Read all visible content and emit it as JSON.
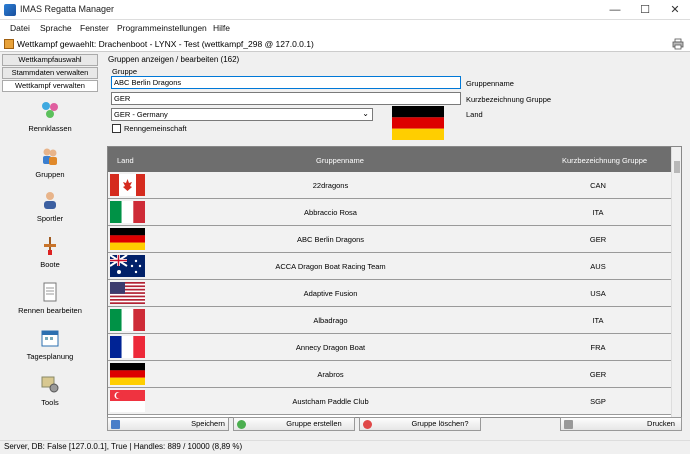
{
  "window": {
    "title": "IMAS Regatta Manager",
    "minimize": "—",
    "maximize": "☐",
    "close": "✕"
  },
  "menu": [
    "Datei",
    "Sprache",
    "Fenster",
    "Programmeinstellungen",
    "Hilfe"
  ],
  "context": {
    "text": "Wettkampf gewaehlt: Drachenboot - LYNX - Test (wettkampf_298 @ 127.0.0.1)"
  },
  "sidebar": {
    "tabs": [
      "Wettkampfauswahl",
      "Stammdaten verwalten",
      "Wettkampf verwalten"
    ],
    "items": [
      {
        "label": "Rennklassen",
        "icon": "molecule-icon"
      },
      {
        "label": "Gruppen",
        "icon": "group-icon"
      },
      {
        "label": "Sportler",
        "icon": "person-icon"
      },
      {
        "label": "Boote",
        "icon": "paddle-icon"
      },
      {
        "label": "Rennen bearbeiten",
        "icon": "document-icon"
      },
      {
        "label": "Tagesplanung",
        "icon": "calendar-icon"
      },
      {
        "label": "Tools",
        "icon": "tools-icon"
      }
    ]
  },
  "form": {
    "section_title": "Gruppen anzeigen / bearbeiten (162)",
    "groupbox_title": "Gruppe",
    "name_value": "ABC Berlin Dragons",
    "name_label": "Gruppenname",
    "short_value": "GER",
    "short_label": "Kurzbezeichnung Gruppe",
    "country_value": "GER - Germany",
    "country_label": "Land",
    "dropdown_arrow": "⌄",
    "renngemeinschaft_label": "Renngemeinschaft"
  },
  "table": {
    "headers": [
      "Land",
      "Gruppenname",
      "Kurzbezeichnung Gruppe"
    ],
    "rows": [
      {
        "flag": "CAN",
        "name": "22dragons",
        "code": "CAN"
      },
      {
        "flag": "ITA",
        "name": "Abbraccio Rosa",
        "code": "ITA"
      },
      {
        "flag": "GER",
        "name": "ABC Berlin Dragons",
        "code": "GER"
      },
      {
        "flag": "AUS",
        "name": "ACCA Dragon Boat Racing Team",
        "code": "AUS"
      },
      {
        "flag": "USA",
        "name": "Adaptive Fusion",
        "code": "USA"
      },
      {
        "flag": "ITA",
        "name": "Albadrago",
        "code": "ITA"
      },
      {
        "flag": "FRA",
        "name": "Annecy Dragon Boat",
        "code": "FRA"
      },
      {
        "flag": "GER",
        "name": "Arabros",
        "code": "GER"
      },
      {
        "flag": "SGP",
        "name": "Austcham Paddle Club",
        "code": "SGP"
      }
    ]
  },
  "buttons": {
    "save": "Speichern",
    "create": "Gruppe erstellen",
    "delete": "Gruppe löschen?",
    "print": "Drucken"
  },
  "status": {
    "text": "Server, DB: False [127.0.0.1], True  |  Handles: 889 / 10000 (8,89 %)"
  },
  "colors": {
    "accent": "#2b7fd6",
    "header_gray": "#6e6e6e"
  }
}
